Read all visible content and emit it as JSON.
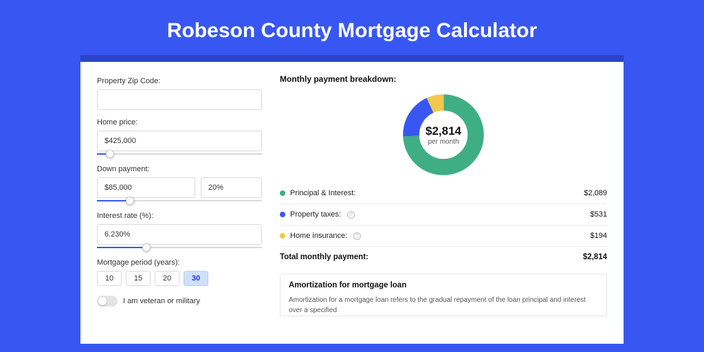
{
  "hero": {
    "title": "Robeson County Mortgage Calculator"
  },
  "form": {
    "zip": {
      "label": "Property Zip Code:",
      "value": ""
    },
    "price": {
      "label": "Home price:",
      "value": "$425,000",
      "slider_pct": 8
    },
    "down": {
      "label": "Down payment:",
      "amount": "$85,000",
      "percent": "20%",
      "slider_pct": 20
    },
    "rate": {
      "label": "Interest rate (%):",
      "value": "6.230%",
      "slider_pct": 30
    },
    "period": {
      "label": "Mortgage period (years):",
      "options": [
        "10",
        "15",
        "20",
        "30"
      ],
      "selected": "30"
    },
    "veteran": {
      "label": "I am veteran or military",
      "on": false
    }
  },
  "breakdown": {
    "title": "Monthly payment breakdown:",
    "center_amount": "$2,814",
    "center_sub": "per month",
    "items": [
      {
        "label": "Principal & Interest:",
        "value": "$2,089",
        "color": "#3fae84",
        "info": false
      },
      {
        "label": "Property taxes:",
        "value": "$531",
        "color": "#3857f2",
        "info": true
      },
      {
        "label": "Home insurance:",
        "value": "$194",
        "color": "#f1c84b",
        "info": true
      }
    ],
    "total_label": "Total monthly payment:",
    "total_value": "$2,814"
  },
  "amortization": {
    "title": "Amortization for mortgage loan",
    "text": "Amortization for a mortgage loan refers to the gradual repayment of the loan principal and interest over a specified"
  },
  "chart_data": {
    "type": "pie",
    "title": "Monthly payment breakdown",
    "series": [
      {
        "name": "Principal & Interest",
        "value": 2089,
        "color": "#3fae84"
      },
      {
        "name": "Property taxes",
        "value": 531,
        "color": "#3857f2"
      },
      {
        "name": "Home insurance",
        "value": 194,
        "color": "#f1c84b"
      }
    ],
    "total": 2814
  }
}
